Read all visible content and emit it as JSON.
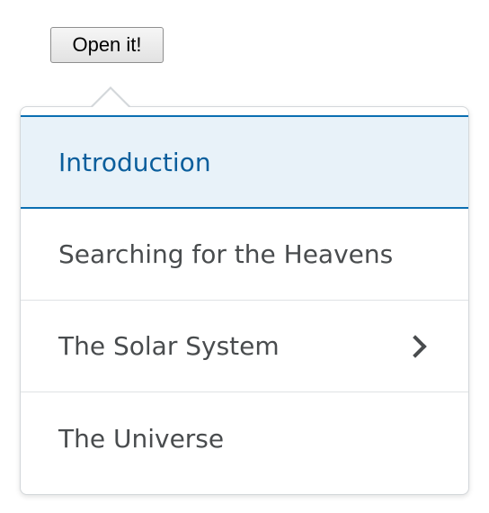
{
  "open_button": {
    "label": "Open it!"
  },
  "menu": {
    "items": [
      {
        "label": "Introduction",
        "selected": true,
        "has_submenu": false
      },
      {
        "label": "Searching for the Heavens",
        "selected": false,
        "has_submenu": false
      },
      {
        "label": "The Solar System",
        "selected": false,
        "has_submenu": true
      },
      {
        "label": "The Universe",
        "selected": false,
        "has_submenu": false
      }
    ]
  },
  "colors": {
    "selected_text": "#0a5e9c",
    "selected_background": "#e8f2f9",
    "selected_border": "#0a6fb2",
    "item_text": "#494c4e"
  },
  "icons": {
    "submenu": "chevron-right-icon"
  }
}
